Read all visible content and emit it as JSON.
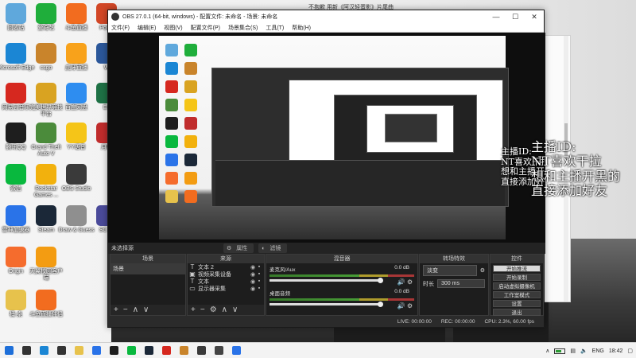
{
  "desktop_icons": [
    {
      "label": "回收站",
      "icon": "recycle-bin-icon",
      "color": "#5fa8dc"
    },
    {
      "label": "爱奇艺",
      "icon": "iqiyi-icon",
      "color": "#1fae3b"
    },
    {
      "label": "斗鱼直播",
      "icon": "douyu-icon",
      "color": "#f26c1f"
    },
    {
      "label": "Powe",
      "icon": "powerpoint-icon",
      "color": "#d24726"
    },
    {
      "label": "Microsoft Edge",
      "icon": "edge-icon",
      "color": "#1b86d4"
    },
    {
      "label": "csgo",
      "icon": "csgo-icon",
      "color": "#c9842b"
    },
    {
      "label": "虎牙直播",
      "icon": "huya-icon",
      "color": "#f8a21b"
    },
    {
      "label": "W",
      "icon": "word-icon",
      "color": "#2b579a"
    },
    {
      "label": "网易云音乐",
      "icon": "netease-music-icon",
      "color": "#d6281f"
    },
    {
      "label": "完美世界竞技平台",
      "icon": "perfect-world-icon",
      "color": "#d9a321"
    },
    {
      "label": "百度网盘",
      "icon": "baidu-netdisk-icon",
      "color": "#2e8df0"
    },
    {
      "label": "Ex",
      "icon": "excel-icon",
      "color": "#1e7145"
    },
    {
      "label": "Grand Theft Auto V",
      "icon": "gta-icon",
      "color": "#4b8b3b"
    },
    {
      "label": "YY语音",
      "icon": "yy-icon",
      "color": "#f5c518"
    },
    {
      "label": "腾讯QQ",
      "icon": "qq-icon",
      "color": "#1e1e1e"
    },
    {
      "label": "月积",
      "icon": "app-icon",
      "color": "#c02c2c"
    },
    {
      "label": "微信",
      "icon": "wechat-icon",
      "color": "#09b83e"
    },
    {
      "label": "Rockstar Games ...",
      "icon": "rockstar-icon",
      "color": "#f2b10d"
    },
    {
      "label": "OBS Studio",
      "icon": "obs-icon",
      "color": "#3a3a3a"
    },
    {
      "label": "雷神加速器",
      "icon": "leishen-icon",
      "color": "#2a73e8"
    },
    {
      "label": "Steam",
      "icon": "steam-icon",
      "color": "#1b2838"
    },
    {
      "label": "Draw & Guess",
      "icon": "draw-guess-icon",
      "color": "#8f8f8f"
    },
    {
      "label": "SC 助",
      "icon": "app-icon",
      "color": "#4a4a9a"
    },
    {
      "label": "Origin",
      "icon": "origin-icon",
      "color": "#f56c2d"
    },
    {
      "label": "天翼校园客户端",
      "icon": "tianyi-icon",
      "color": "#f39c12"
    },
    {
      "label": "桶 桌",
      "icon": "folder-icon",
      "color": "#e7c24c"
    },
    {
      "label": "斗鱼直播伴侣",
      "icon": "douyu-companion-icon",
      "color": "#f26c1f"
    }
  ],
  "film_title": "不抱歉 用新《阿汉轻蛋影》片尾曲",
  "obs": {
    "title": "OBS 27.0.1 (64-bit, windows) - 配置文件: 未命名 - 场景: 未命名",
    "menu": [
      "文件(F)",
      "编辑(E)",
      "视图(V)",
      "配置文件(P)",
      "场景集合(S)",
      "工具(T)",
      "帮助(H)"
    ],
    "no_source": "未选择源",
    "props_label": "属性",
    "filters_label": "滤镜",
    "docks": {
      "scenes": "场景",
      "sources": "来源",
      "mixer": "混音器",
      "transitions": "转场特效",
      "controls": "控件"
    },
    "scene_items": [
      "场景"
    ],
    "source_items": [
      {
        "icon": "T",
        "label": "文本 2"
      },
      {
        "icon": "▣",
        "label": "视频采集设备"
      },
      {
        "icon": "T",
        "label": "文本"
      },
      {
        "icon": "▭",
        "label": "显示器采集"
      }
    ],
    "mixer": [
      {
        "name": "麦克风/Aux",
        "db": "0.0 dB",
        "level": 0.62
      },
      {
        "name": "桌面音频",
        "db": "0.0 dB",
        "level": 0.62
      }
    ],
    "transition": {
      "type": "淡变",
      "duration_label": "时长",
      "duration": "300 ms"
    },
    "controls": [
      "开始推流",
      "开始录制",
      "启动虚拟摄像机",
      "工作室模式",
      "设置",
      "退出"
    ],
    "status": {
      "live": "LIVE: 00:00:00",
      "rec": "REC: 00:00:00",
      "cpu": "CPU: 2.3%, 60.00 fps"
    }
  },
  "overlay_text": [
    "主播ID:",
    "NT喜欢干拉",
    "想和主播开黑的",
    "直接添加好友"
  ],
  "overlay_small_text": [
    "主播ID:",
    "NT喜欢干拉",
    "想和主播开黑的",
    "直接添加好友"
  ],
  "taskbar": {
    "lang": "ENG",
    "time": "18:42",
    "apps": [
      {
        "icon": "windows-start-icon",
        "color": "#1e6fd9"
      },
      {
        "icon": "search-icon",
        "color": "#333333"
      },
      {
        "icon": "edge-icon",
        "color": "#1b86d4"
      },
      {
        "icon": "task-view-icon",
        "color": "#333333"
      },
      {
        "icon": "file-explorer-icon",
        "color": "#e7c24c"
      },
      {
        "icon": "store-icon",
        "color": "#2a73e8"
      },
      {
        "icon": "qq-icon",
        "color": "#1e1e1e"
      },
      {
        "icon": "wechat-icon",
        "color": "#09b83e"
      },
      {
        "icon": "steam-icon",
        "color": "#1b2838"
      },
      {
        "icon": "netease-music-icon",
        "color": "#d6281f"
      },
      {
        "icon": "csgo-icon",
        "color": "#c9842b"
      },
      {
        "icon": "obs-icon",
        "color": "#3a3a3a"
      },
      {
        "icon": "music-icon",
        "color": "#444444"
      },
      {
        "icon": "photo-icon",
        "color": "#2a73e8"
      }
    ]
  }
}
